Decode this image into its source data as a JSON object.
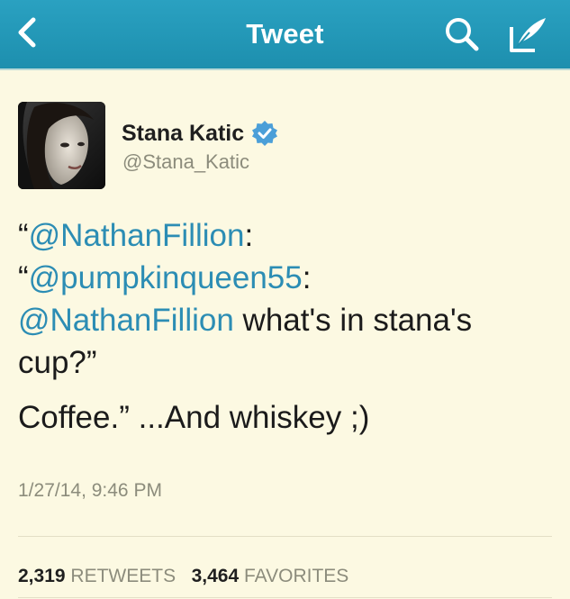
{
  "header": {
    "title": "Tweet",
    "icons": {
      "back": "chevron-left-icon",
      "search": "search-icon",
      "compose": "compose-tweet-icon"
    },
    "background": "#2aa1c1"
  },
  "tweet": {
    "author": {
      "name": "Stana Katic",
      "handle": "@Stana_Katic",
      "verified": true
    },
    "body": {
      "q1": "“",
      "mention1": "@NathanFillion",
      "colon1": ":",
      "q2": "“",
      "mention2": "@pumpkinqueen55",
      "colon2": ":",
      "mention3": "@NathanFillion",
      "text3": " what's in stana's cup?”",
      "line2": "Coffee.” ...And whiskey ;)"
    },
    "timestamp": "1/27/14, 9:46 PM",
    "stats": {
      "retweets_count": "2,319",
      "retweets_label": "RETWEETS",
      "favorites_count": "3,464",
      "favorites_label": "FAVORITES"
    }
  },
  "colors": {
    "background": "#fcf9e2",
    "link": "#2c8db4",
    "verified": "#4b9fd8"
  }
}
